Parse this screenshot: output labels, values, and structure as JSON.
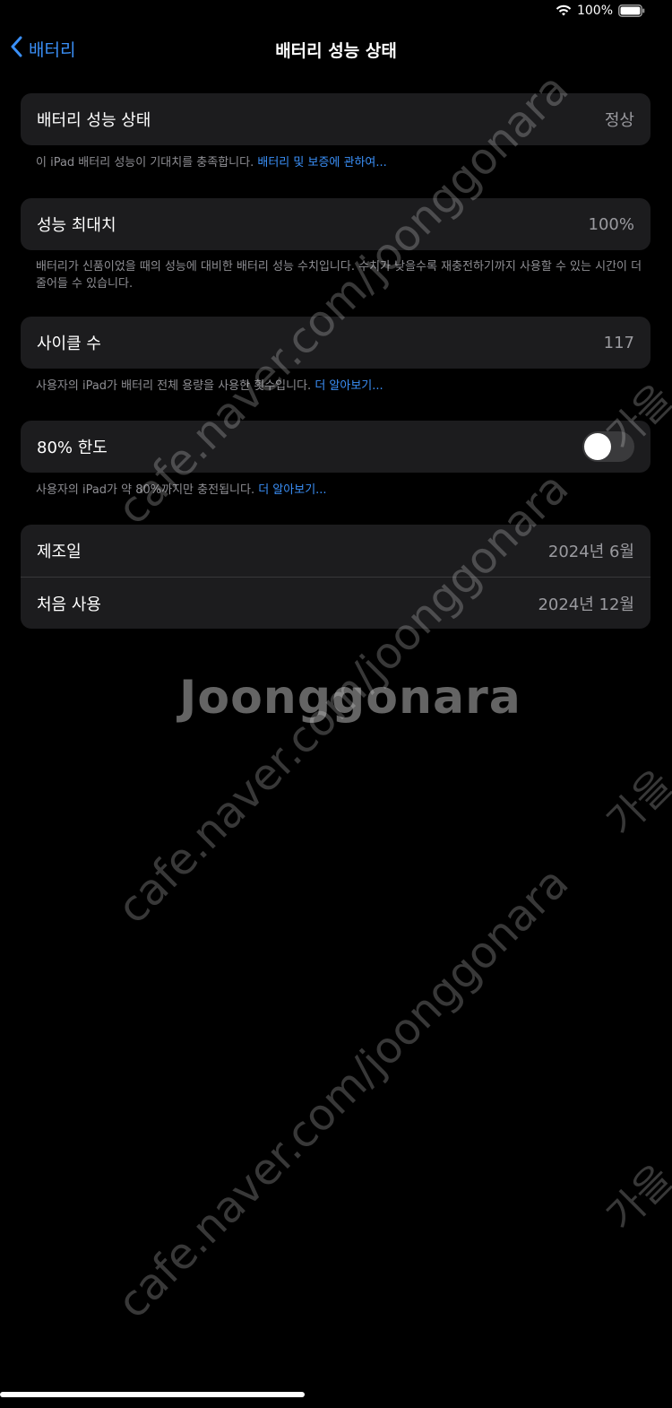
{
  "status": {
    "battery_percent": "100%",
    "battery_level": 1.0
  },
  "nav": {
    "back_label": "배터리",
    "title": "배터리 성능 상태"
  },
  "health": {
    "label": "배터리 성능 상태",
    "value": "정상",
    "footnote_text": "이 iPad 배터리 성능이 기대치를 충족합니다. ",
    "footnote_link": "배터리 및 보증에 관하여..."
  },
  "max_capacity": {
    "label": "성능 최대치",
    "value": "100%",
    "footnote_text": "배터리가 신품이었을 때의 성능에 대비한 배터리 성능 수치입니다. 수치가 낮을수록 재충전하기까지 사용할 수 있는 시간이 더 줄어들 수 있습니다."
  },
  "cycle_count": {
    "label": "사이클 수",
    "value": "117",
    "footnote_text": "사용자의 iPad가 배터리 전체 용량을 사용한 횟수입니다. ",
    "footnote_link": "더 알아보기..."
  },
  "limit_80": {
    "label": "80% 한도",
    "toggle_on": false,
    "footnote_text": "사용자의 iPad가 약 80%까지만 충전됩니다. ",
    "footnote_link": "더 알아보기..."
  },
  "dates": {
    "manufacture_label": "제조일",
    "manufacture_value": "2024년 6월",
    "first_use_label": "처음 사용",
    "first_use_value": "2024년 12월"
  },
  "watermark": {
    "url": "cafe.naver.com/joonggonara",
    "logo": "Joonggonara",
    "korean": "가을"
  },
  "colors": {
    "background": "#000000",
    "cell": "#1c1c1e",
    "accent": "#3a8ff7",
    "secondary": "#8e8e93"
  },
  "icons": {
    "wifi": "wifi-icon",
    "battery": "battery-icon",
    "back": "chevron-left-icon"
  }
}
